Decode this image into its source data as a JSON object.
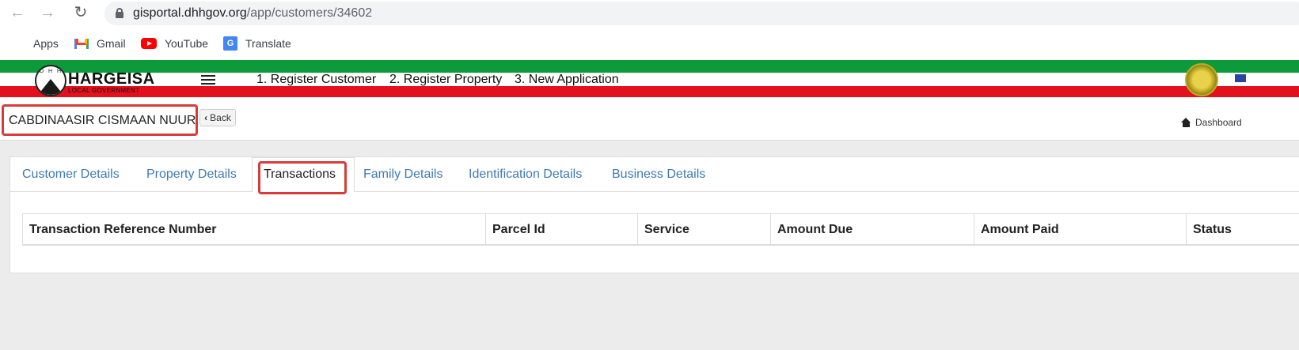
{
  "browser": {
    "url_host": "gisportal.dhhgov.org",
    "url_path": "/app/customers/34602",
    "bookmarks": [
      {
        "label": "Apps",
        "icon": "apps-grid-icon"
      },
      {
        "label": "Gmail",
        "icon": "gmail-icon"
      },
      {
        "label": "YouTube",
        "icon": "youtube-icon"
      },
      {
        "label": "Translate",
        "icon": "translate-icon"
      }
    ],
    "colors": {
      "apps": [
        "#ea4335",
        "#fbbc04",
        "#34a853",
        "#4285f4",
        "#ea4335",
        "#fbbc04",
        "#34a853",
        "#4285f4",
        "#ea4335"
      ]
    }
  },
  "header": {
    "logo_letters": "D H H",
    "brand": "HARGEISA",
    "brand_sub": "LOCAL GOVERNMENT",
    "menu": [
      "1. Register Customer",
      "2. Register Property",
      "3. New Application"
    ],
    "colors": {
      "green": "#0c9a3b",
      "red": "#e3101e"
    }
  },
  "page": {
    "customer_name": "CABDINAASIR CISMAAN NUUR",
    "back_label": "Back",
    "breadcrumb": "Dashboard"
  },
  "tabs": [
    "Customer Details",
    "Property Details",
    "Transactions",
    "Family Details",
    "Identification Details",
    "Business Details"
  ],
  "active_tab": "Transactions",
  "table": {
    "columns": [
      "Transaction Reference Number",
      "Parcel Id",
      "Service",
      "Amount Due",
      "Amount Paid",
      "Status"
    ],
    "rows": []
  },
  "highlight_color": "#d83b3b",
  "link_color": "#3f7ab5"
}
